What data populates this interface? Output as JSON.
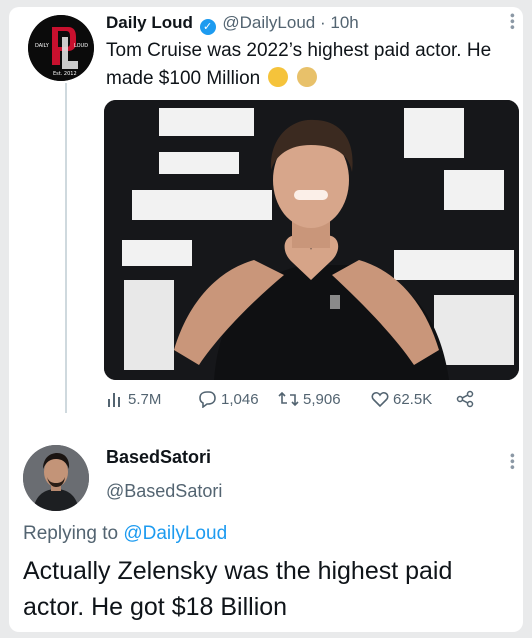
{
  "original_tweet": {
    "author_name": "Daily Loud",
    "handle": "@DailyLoud",
    "separator": "·",
    "time": "10h",
    "text": "Tom Cruise was 2022’s highest paid actor. He made $100 Million",
    "emojis": [
      "exploding-head-emoji",
      "money-bag-emoji"
    ],
    "avatar_text": {
      "left": "DAILY",
      "right": "LOUD",
      "bottom": "Est. 2012"
    },
    "media_icon": "photo-of-man-making-heart-hands",
    "stats": {
      "views": "5.7M",
      "replies": "1,046",
      "retweets": "5,906",
      "likes": "62.5K"
    }
  },
  "reply_tweet": {
    "author_name": "BasedSatori",
    "handle": "@BasedSatori",
    "replying_prefix": "Replying to",
    "replying_to": "@DailyLoud",
    "text": "Actually Zelensky was the highest paid actor. He got $18 Billion"
  },
  "colors": {
    "verified": "#1d9bf0",
    "secondary_text": "#536471",
    "link": "#1d9bf0",
    "thread_line": "#cfd9de"
  }
}
